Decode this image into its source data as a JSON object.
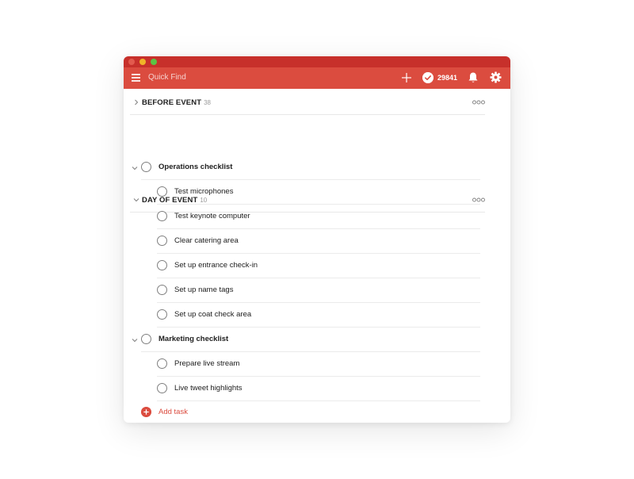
{
  "toolbar": {
    "search_placeholder": "Quick Find",
    "karma_score": "29841"
  },
  "sections": [
    {
      "title": "BEFORE EVENT",
      "count": "38",
      "expanded": false
    },
    {
      "title": "DAY OF EVENT",
      "count": "10",
      "expanded": true
    }
  ],
  "tasks": {
    "operations": {
      "label": "Operations checklist",
      "subtasks": [
        "Test microphones",
        "Test keynote computer",
        "Clear catering area",
        "Set up entrance check-in",
        "Set up name tags",
        "Set up coat check area"
      ]
    },
    "marketing": {
      "label": "Marketing checklist",
      "subtasks": [
        "Prepare live stream",
        "Live tweet highlights"
      ]
    }
  },
  "add_task_label": "Add task",
  "colors": {
    "brand": "#db4c3f",
    "titlebar": "#c7302b",
    "text": "#202020",
    "muted": "#999999"
  },
  "icons": [
    "menu-icon",
    "plus-icon",
    "karma-icon",
    "bell-icon",
    "gear-icon",
    "chevron-right-icon",
    "chevron-down-icon",
    "more-icon",
    "circle-checkbox",
    "add-icon"
  ]
}
